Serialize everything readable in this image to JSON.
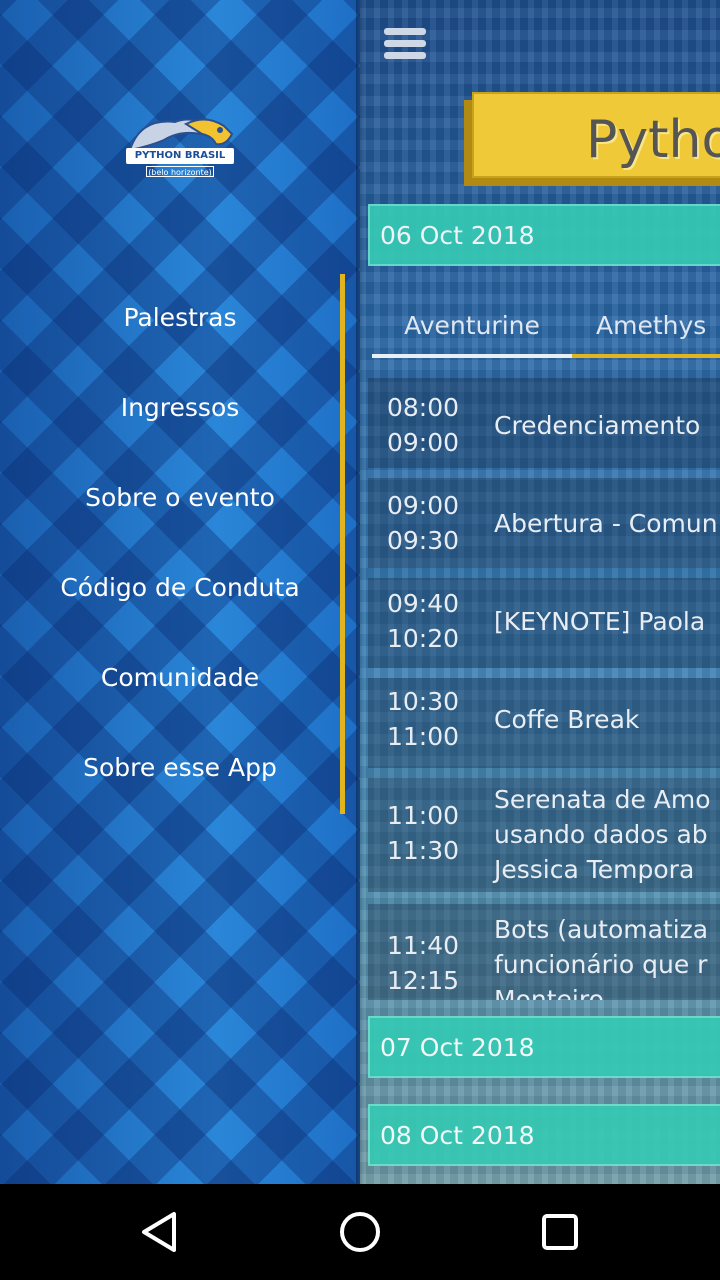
{
  "drawer": {
    "logo_text": "PYTHON BRASIL",
    "logo_subtext": "(belo horizonte)",
    "items": [
      {
        "label": "Palestras"
      },
      {
        "label": "Ingressos"
      },
      {
        "label": "Sobre o evento"
      },
      {
        "label": "Código de Conduta"
      },
      {
        "label": "Comunidade"
      },
      {
        "label": "Sobre esse App"
      }
    ],
    "accent_color": "#e2b51f"
  },
  "main": {
    "title": "Pytho",
    "dates": [
      {
        "label": "06 Oct 2018"
      },
      {
        "label": "07 Oct 2018"
      },
      {
        "label": "08 Oct 2018"
      }
    ],
    "tabs": [
      {
        "label": "Aventurine"
      },
      {
        "label": "Amethys"
      }
    ],
    "schedule": [
      {
        "start": "08:00",
        "end": "09:00",
        "title_lines": [
          "Credenciamento"
        ]
      },
      {
        "start": "09:00",
        "end": "09:30",
        "title_lines": [
          "Abertura - Comun"
        ]
      },
      {
        "start": "09:40",
        "end": "10:20",
        "title_lines": [
          "[KEYNOTE] Paola"
        ]
      },
      {
        "start": "10:30",
        "end": "11:00",
        "title_lines": [
          "Coffe Break"
        ]
      },
      {
        "start": "11:00",
        "end": "11:30",
        "title_lines": [
          "Serenata de Amo",
          "usando dados ab",
          "Jessica Tempora"
        ]
      },
      {
        "start": "11:40",
        "end": "12:15",
        "title_lines": [
          "Bots (automatiza",
          "funcionário que r",
          "Monteiro"
        ]
      }
    ],
    "date_bar_color": "#35c9b4",
    "title_box_color": "#f0c938"
  },
  "navbar": {
    "back_icon": "back-triangle-icon",
    "home_icon": "home-circle-icon",
    "recents_icon": "recents-square-icon"
  }
}
